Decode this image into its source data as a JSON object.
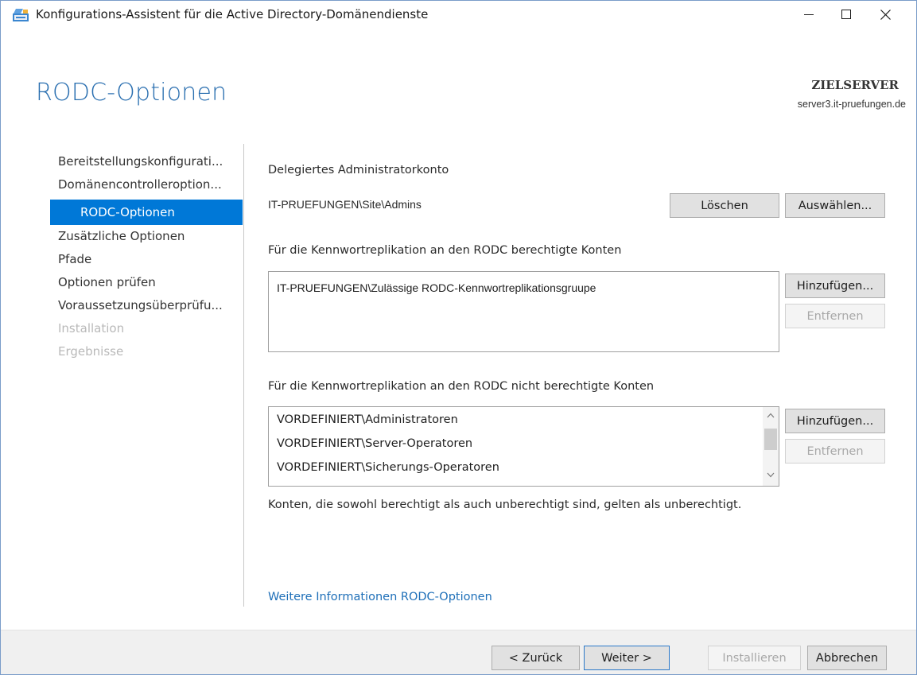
{
  "window": {
    "title": "Konfigurations-Assistent für die Active Directory-Domänendienste"
  },
  "header": {
    "page_title": "RODC-Optionen",
    "target_label": "ZIELSERVER",
    "target_server": "server3.it-pruefungen.de"
  },
  "nav": {
    "items": [
      {
        "label": "Bereitstellungskonfigurati...",
        "state": "normal"
      },
      {
        "label": "Domänencontrolleroption...",
        "state": "normal"
      },
      {
        "label": "RODC-Optionen",
        "state": "active"
      },
      {
        "label": "Zusätzliche Optionen",
        "state": "normal"
      },
      {
        "label": "Pfade",
        "state": "normal"
      },
      {
        "label": "Optionen prüfen",
        "state": "normal"
      },
      {
        "label": "Voraussetzungsüberprüfu...",
        "state": "normal"
      },
      {
        "label": "Installation",
        "state": "disabled"
      },
      {
        "label": "Ergebnisse",
        "state": "disabled"
      }
    ]
  },
  "delegated": {
    "label": "Delegiertes Administratorkonto",
    "value": "IT-PRUEFUNGEN\\Site\\Admins",
    "delete_label": "Löschen",
    "select_label": "Auswählen..."
  },
  "allowed": {
    "label": "Für die Kennwortreplikation an den RODC berechtigte Konten",
    "items": [
      "IT-PRUEFUNGEN\\Zulässige RODC-Kennwortreplikationsgruupe"
    ],
    "add_label": "Hinzufügen...",
    "remove_label": "Entfernen"
  },
  "denied": {
    "label": "Für die Kennwortreplikation an den RODC nicht berechtigte Konten",
    "items": [
      "VORDEFINIERT\\Administratoren",
      "VORDEFINIERT\\Server-Operatoren",
      "VORDEFINIERT\\Sicherungs-Operatoren"
    ],
    "add_label": "Hinzufügen...",
    "remove_label": "Entfernen"
  },
  "note": "Konten, die sowohl berechtigt als auch unberechtigt sind, gelten als unberechtigt.",
  "more_info_link": "Weitere Informationen RODC-Optionen",
  "footer": {
    "back_label": "< Zurück",
    "next_label": "Weiter >",
    "install_label": "Installieren",
    "cancel_label": "Abbrechen"
  },
  "colors": {
    "accent": "#0078d7",
    "title_blue": "#2a6fb0",
    "link_blue": "#1e6fb8"
  }
}
